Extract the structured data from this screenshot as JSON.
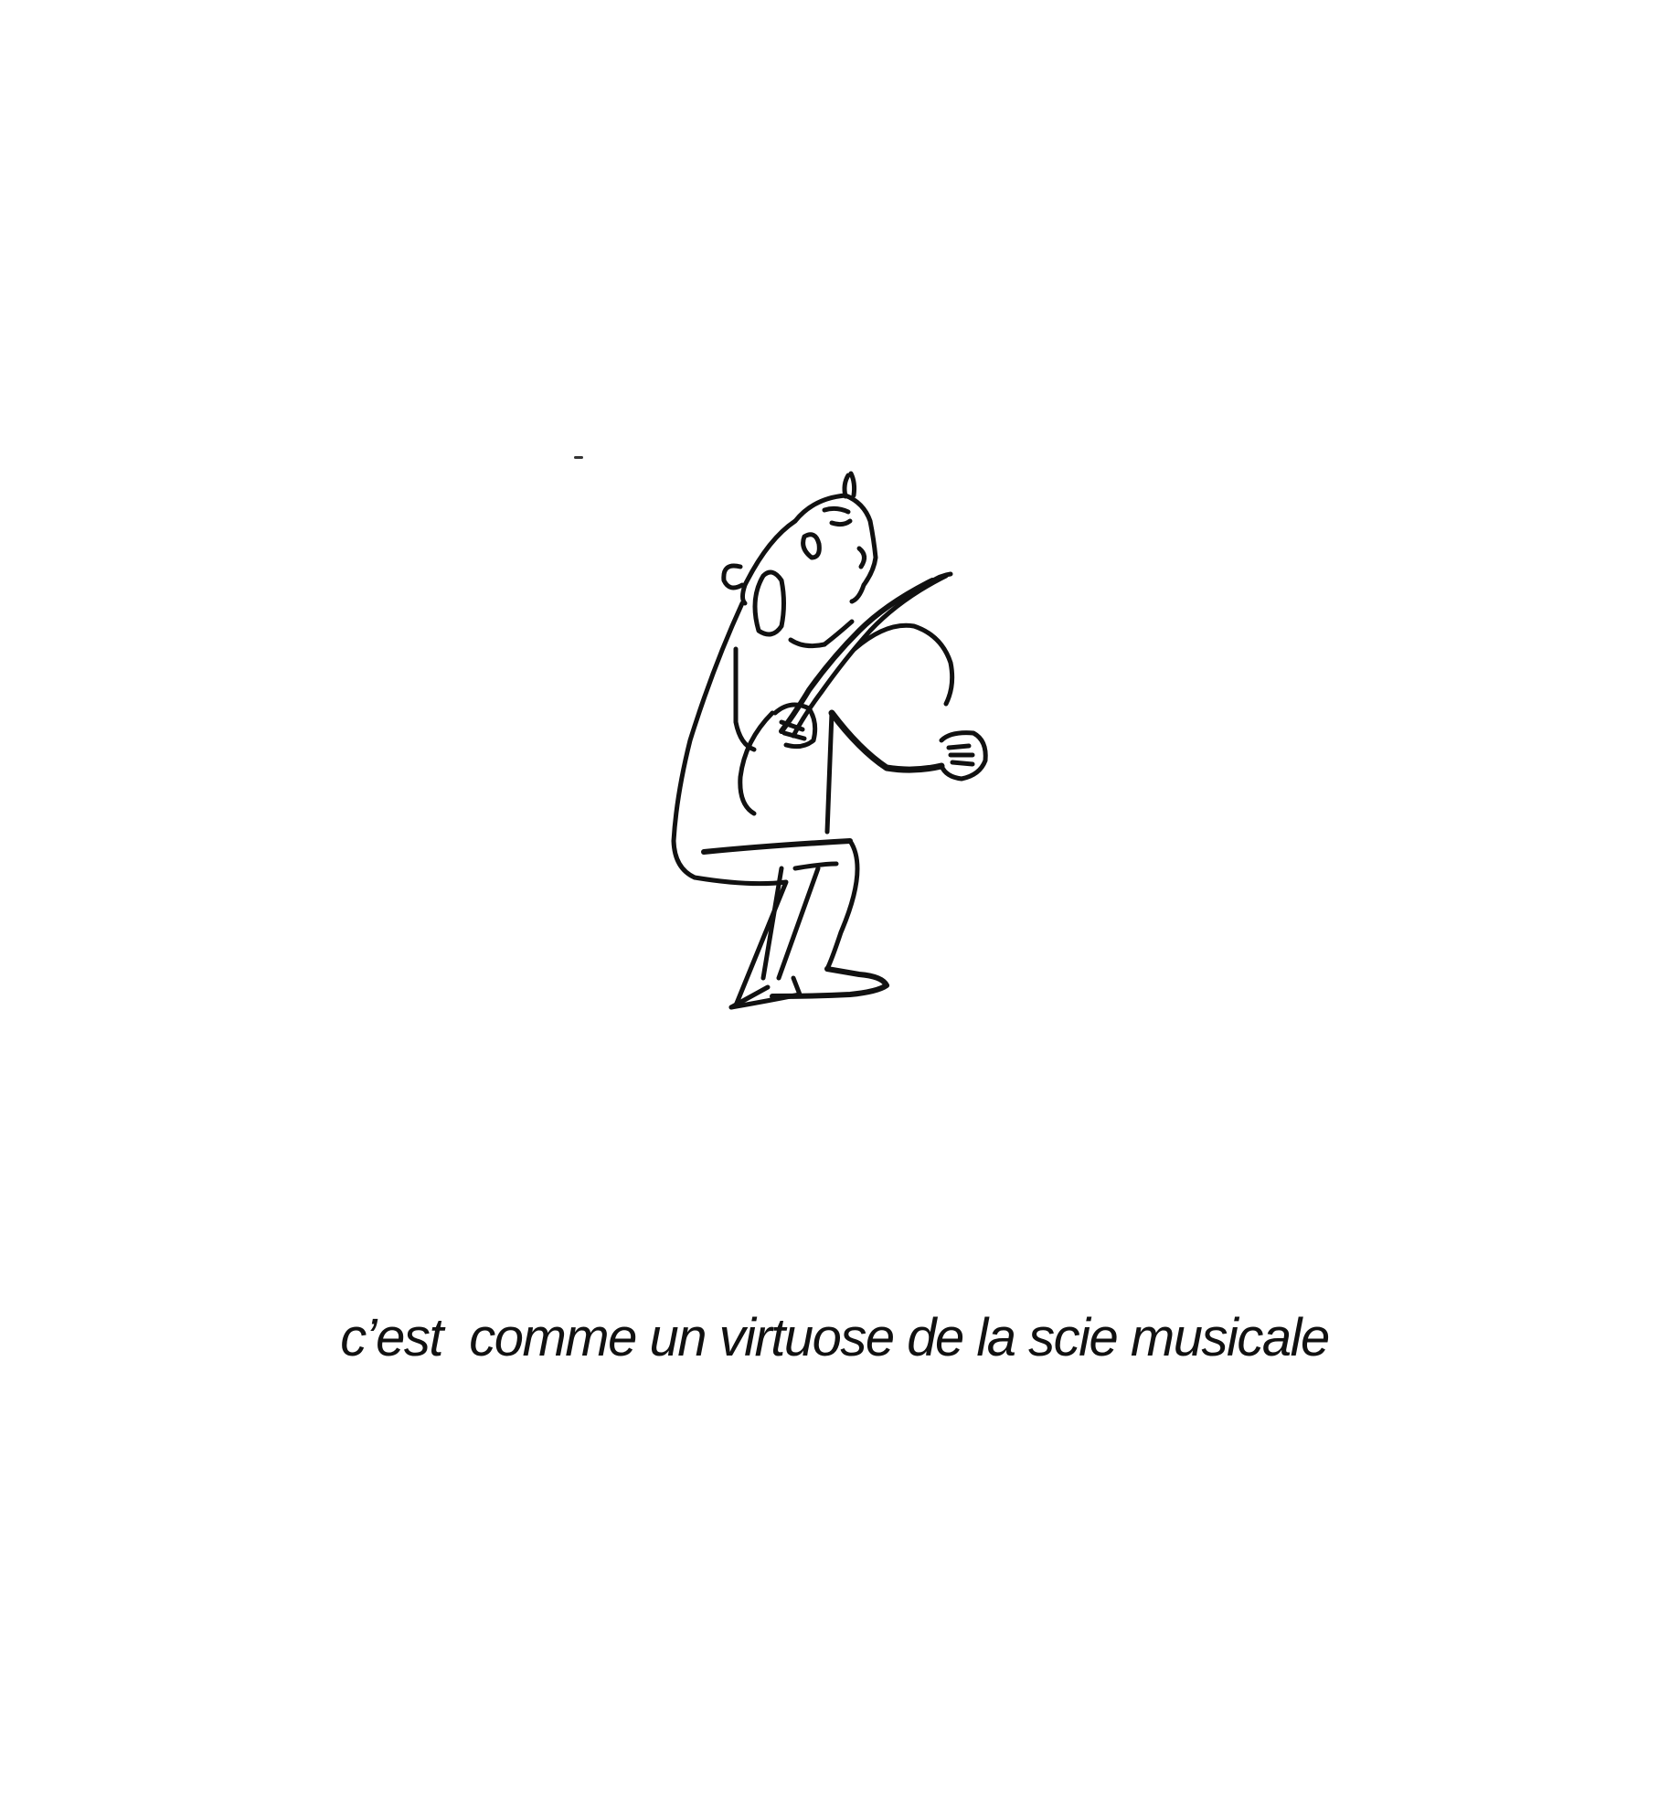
{
  "caption": {
    "text": "c’est  comme un virtuose de la scie musicale"
  },
  "illustration": {
    "subject": "musician-playing-saw-drawing",
    "ink_color": "#111111",
    "background_color": "#ffffff"
  }
}
